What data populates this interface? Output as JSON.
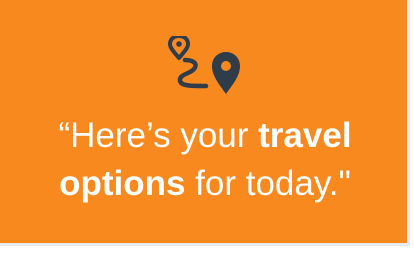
{
  "card": {
    "background": "#f7891f",
    "icon": "route-pins-icon",
    "icon_color": "#2f3c4a",
    "message": {
      "part1": "“Here’s your ",
      "highlight1": "travel",
      "part2": " ",
      "highlight2": "options",
      "part3": " for today.\""
    }
  }
}
